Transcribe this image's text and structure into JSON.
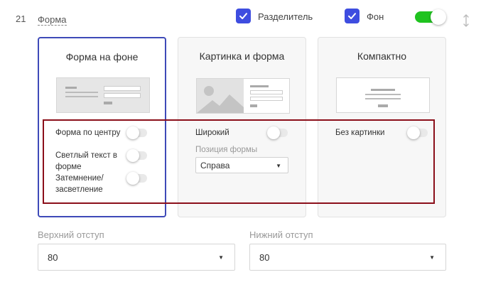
{
  "row": {
    "number": "21",
    "link": "Форма"
  },
  "header": {
    "separator": {
      "label": "Разделитель",
      "checked": true
    },
    "background": {
      "label": "Фон",
      "checked": true
    },
    "toggle_on": true
  },
  "cards": [
    {
      "title": "Форма на фоне",
      "selected": true,
      "options": [
        {
          "label": "Форма по центру",
          "on": false
        },
        {
          "label": "Светлый текст в форме",
          "on": false
        },
        {
          "label": "Затемнение/ засветление",
          "on": false
        }
      ]
    },
    {
      "title": "Картинка и форма",
      "options": [
        {
          "label": "Широкий",
          "on": false
        }
      ],
      "position_label": "Позиция формы",
      "position_value": "Справа"
    },
    {
      "title": "Компактно",
      "options": [
        {
          "label": "Без картинки",
          "on": false
        }
      ]
    }
  ],
  "padding": {
    "top": {
      "label": "Верхний отступ",
      "value": "80"
    },
    "bottom": {
      "label": "Нижний отступ",
      "value": "80"
    }
  },
  "colors": {
    "accent": "#3e4de0",
    "toggle_on": "#1fc31f",
    "selected_border": "#3e4ab8",
    "highlight_frame": "#8b0f1a"
  }
}
